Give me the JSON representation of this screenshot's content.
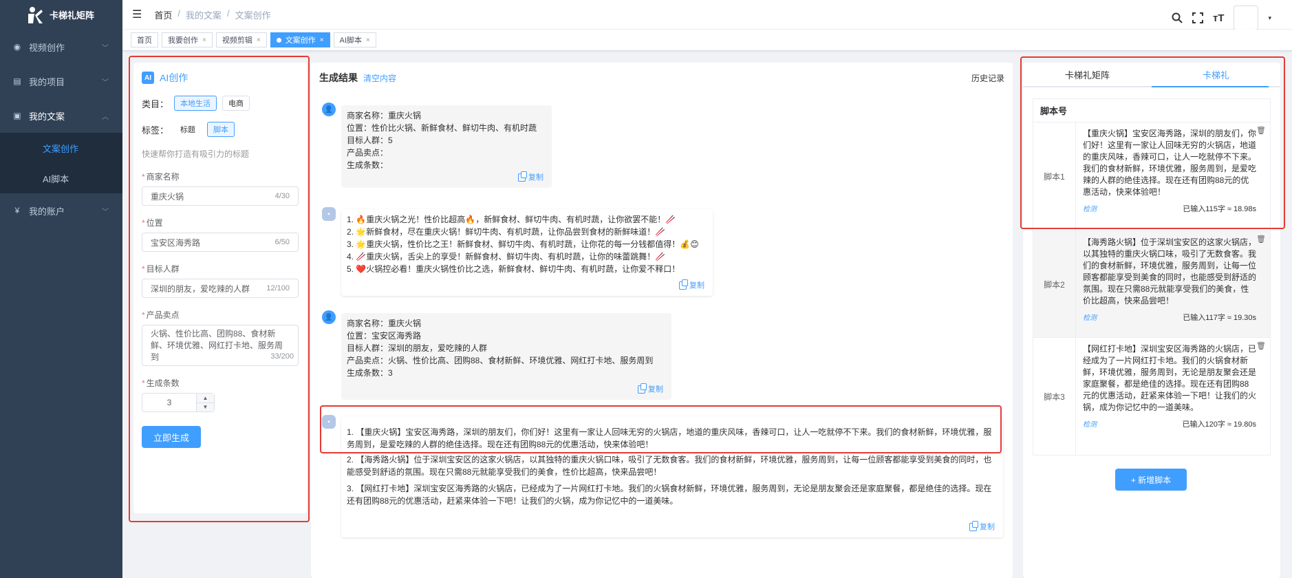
{
  "app": {
    "name": "卡梯礼矩阵"
  },
  "sidebar": {
    "items": [
      {
        "label": "视频创作"
      },
      {
        "label": "我的项目"
      },
      {
        "label": "我的文案"
      },
      {
        "label": "我的账户"
      }
    ],
    "subitems": [
      {
        "label": "文案创作"
      },
      {
        "label": "AI脚本"
      }
    ]
  },
  "breadcrumb": {
    "items": [
      "首页",
      "/",
      "我的文案",
      "/",
      "文案创作"
    ]
  },
  "tags": [
    {
      "label": "首页"
    },
    {
      "label": "我要创作"
    },
    {
      "label": "视频剪辑"
    },
    {
      "label": "文案创作"
    },
    {
      "label": "AI脚本"
    }
  ],
  "left": {
    "title": "AI创作",
    "badge": "AI",
    "category_label": "类目：",
    "categories": [
      "本地生活",
      "电商"
    ],
    "tag_label": "标签：",
    "tags": [
      "标题",
      "脚本"
    ],
    "hint": "快速帮你打造有吸引力的标题",
    "fields": {
      "merchant": {
        "label": "商家名称",
        "value": "重庆火锅",
        "count": "4/30"
      },
      "location": {
        "label": "位置",
        "value": "宝安区海秀路",
        "count": "6/50"
      },
      "audience": {
        "label": "目标人群",
        "value": "深圳的朋友，爱吃辣的人群",
        "count": "12/100"
      },
      "selling": {
        "label": "产品卖点",
        "value": "火锅、性价比高、团购88、食材新鲜、环境优雅、网红打卡地、服务周到",
        "count": "33/200"
      },
      "quantity": {
        "label": "生成条数",
        "value": "3"
      }
    },
    "submit": "立即生成"
  },
  "middle": {
    "title": "生成结果",
    "clear": "清空内容",
    "history": "历史记录",
    "copy": "复制",
    "messages": [
      {
        "lines": [
          "商家名称：重庆火锅",
          "位置：性价比火锅、新鲜食材、鲜切牛肉、有机时蔬",
          "目标人群：5",
          "产品卖点：",
          "生成条数："
        ]
      },
      {
        "lines": [
          "1. 🔥重庆火锅之光！性价比超高🔥，新鲜食材、鲜切牛肉、有机时蔬，让你欲罢不能！🥢",
          "2. 🌟新鲜食材，尽在重庆火锅！鲜切牛肉、有机时蔬，让你品尝到食材的新鲜味道！🥢",
          "3. 🌟重庆火锅，性价比之王！新鲜食材、鲜切牛肉、有机时蔬，让你花的每一分钱都值得！💰😊",
          "4. 🥢重庆火锅，舌尖上的享受！新鲜食材、鲜切牛肉、有机时蔬，让你的味蕾跳舞！🥢",
          "5. ❤️火锅控必看！重庆火锅性价比之选，新鲜食材、鲜切牛肉、有机时蔬，让你爱不释口！"
        ]
      },
      {
        "lines": [
          "商家名称：重庆火锅",
          "位置：宝安区海秀路",
          "目标人群：深圳的朋友，爱吃辣的人群",
          "产品卖点：火锅、性价比高、团购88、食材新鲜、环境优雅、网红打卡地、服务周到",
          "生成条数：3"
        ]
      },
      {
        "paragraphs": [
          "1. 【重庆火锅】宝安区海秀路，深圳的朋友们，你们好！这里有一家让人回味无穷的火锅店，地道的重庆风味，香辣可口，让人一吃就停不下来。我们的食材新鲜，环境优雅，服务周到，是爱吃辣的人群的绝佳选择。现在还有团购88元的优惠活动，快来体验吧！",
          "2. 【海秀路火锅】位于深圳宝安区的这家火锅店，以其独特的重庆火锅口味，吸引了无数食客。我们的食材新鲜，环境优雅，服务周到，让每一位顾客都能享受到美食的同时，也能感受到舒适的氛围。现在只需88元就能享受我们的美食，性价比超高，快来品尝吧！",
          "3. 【网红打卡地】深圳宝安区海秀路的火锅店，已经成为了一片网红打卡地。我们的火锅食材新鲜，环境优雅，服务周到，无论是朋友聚会还是家庭聚餐，都是绝佳的选择。现在还有团购88元的优惠活动，赶紧来体验一下吧！让我们的火锅，成为你记忆中的一道美味。"
        ]
      }
    ]
  },
  "right": {
    "tabs": [
      "卡梯礼矩阵",
      "卡梯礼"
    ],
    "table_header": "脚本号",
    "rows": [
      {
        "name": "脚本1",
        "text": "【重庆火锅】宝安区海秀路，深圳的朋友们，你们好！这里有一家让人回味无穷的火锅店，地道的重庆风味，香辣可口，让人一吃就停不下来。我们的食材新鲜，环境优雅，服务周到，是爱吃辣的人群的绝佳选择。现在还有团购88元的优惠活动，快来体验吧！",
        "check": "检测",
        "meta": "已输入115字 ≈ 18.98s"
      },
      {
        "name": "脚本2",
        "text": "【海秀路火锅】位于深圳宝安区的这家火锅店，以其独特的重庆火锅口味，吸引了无数食客。我们的食材新鲜，环境优雅，服务周到，让每一位顾客都能享受到美食的同时，也能感受到舒适的氛围。现在只需88元就能享受我们的美食，性价比超高，快来品尝吧！",
        "check": "检测",
        "meta": "已输入117字 ≈ 19.30s"
      },
      {
        "name": "脚本3",
        "text": "【网红打卡地】深圳宝安区海秀路的火锅店，已经成为了一片网红打卡地。我们的火锅食材新鲜，环境优雅，服务周到，无论是朋友聚会还是家庭聚餐，都是绝佳的选择。现在还有团购88元的优惠活动，赶紧来体验一下吧！让我们的火锅，成为你记忆中的一道美味。",
        "check": "检测",
        "meta": "已输入120字 ≈ 19.80s"
      }
    ],
    "add": "+ 新增脚本"
  },
  "colors": {
    "accent": "#409eff",
    "sidebar": "#304156",
    "highlight": "#e53935"
  }
}
